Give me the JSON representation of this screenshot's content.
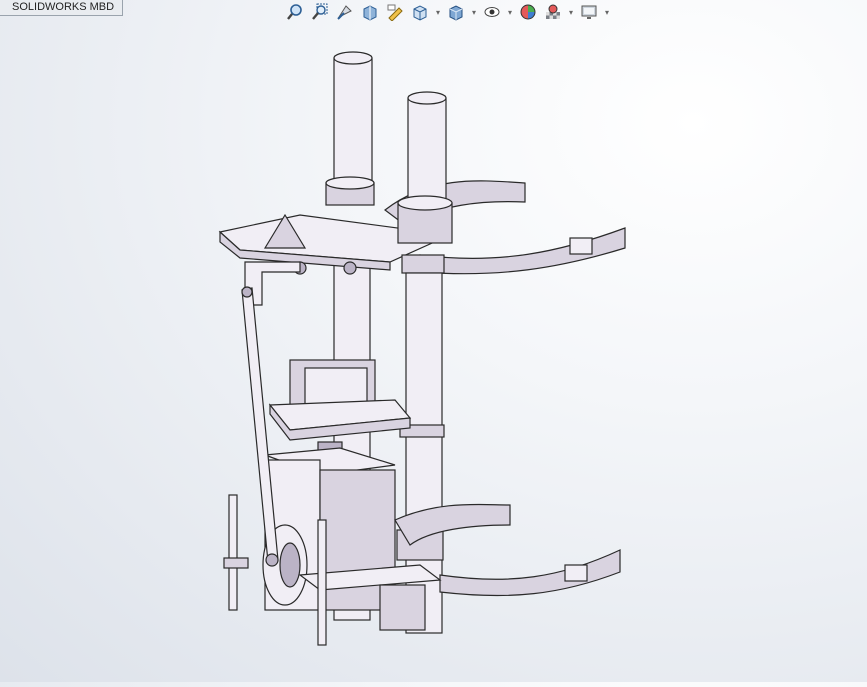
{
  "app": {
    "tab_label": "SOLIDWORKS MBD"
  },
  "heads_up_toolbar": {
    "buttons": [
      {
        "icon": "zoom-to-fit-icon"
      },
      {
        "icon": "zoom-to-area-icon"
      },
      {
        "icon": "previous-view-icon"
      },
      {
        "icon": "section-view-icon"
      },
      {
        "icon": "dynamic-annotation-views-icon"
      },
      {
        "icon": "view-orientation-icon",
        "dropdown": true
      },
      {
        "icon": "display-style-icon",
        "dropdown": true
      },
      {
        "icon": "hide-show-items-icon",
        "dropdown": true
      },
      {
        "icon": "edit-appearance-icon"
      },
      {
        "icon": "apply-scene-icon",
        "dropdown": true
      },
      {
        "icon": "view-settings-icon",
        "dropdown": true
      }
    ]
  },
  "colors": {
    "part_light": "#f1eef5",
    "part_mid": "#d9d3e0",
    "part_dark": "#bbb3c6",
    "edge": "#2a2a2a",
    "background_top": "#ffffff",
    "background_bottom": "#dde2ea"
  }
}
